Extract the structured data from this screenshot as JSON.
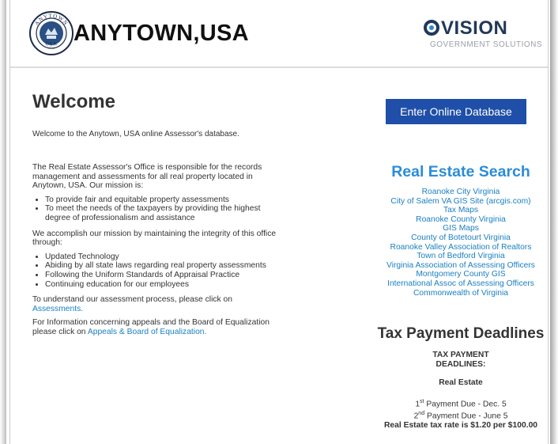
{
  "header": {
    "town_name": "ANYTOWN,USA",
    "seal_top_text": "ANYTOWN",
    "seal_bottom_text": "USA",
    "vision_word": "VISION",
    "vision_sub": "GOVERNMENT SOLUTIONS"
  },
  "welcome": {
    "title": "Welcome",
    "text": "Welcome to the Anytown, USA online Assessor's database."
  },
  "about": {
    "intro": "The Real Estate Assessor's Office is responsible for the records management and assessments for all real property located in Anytown, USA. Our mission is:",
    "mission": [
      "To provide fair and equitable property assessments",
      "To meet the needs of the taxpayers by providing the highest degree of professionalism and assistance"
    ],
    "accomplish": "We accomplish our mission by maintaining the integrity of this office through:",
    "methods": [
      "Updated Technology",
      "Abiding by all state laws regarding real property assessments",
      "Following the Uniform Standards of Appraisal Practice",
      "Continuing education for our employees"
    ],
    "assess_text": "To understand our assessment process, please click on",
    "assess_link": "Assessments.",
    "appeals_text": "For Information concerning appeals and the Board of Equalization please click on",
    "appeals_link": "Appeals & Board of Equalization."
  },
  "enter_button": "Enter Online Database",
  "real_estate": {
    "title": "Real Estate Search",
    "links": [
      "Roanoke City Virginia",
      "City of Salem VA GIS Site (arcgis.com)",
      "Tax Maps",
      "Roanoke County Virginia",
      "GIS Maps",
      "County of Botetourt Virginia",
      "Roanoke Valley Association of Realtors",
      "Town of Bedford Virginia",
      "Virginia Association of Assessing Officers",
      "Montgomery County GIS",
      "International Assoc of Assessing Officers",
      "Commonwealth of Virginia"
    ]
  },
  "tax": {
    "title": "Tax Payment Deadlines",
    "head_line1": "TAX PAYMENT",
    "head_line2": "DEADLINES:",
    "sub": "Real Estate",
    "first_sup": "st",
    "first_num": "1",
    "first_text": "Payment Due - Dec. 5",
    "second_sup": "nd",
    "second_num": "2",
    "second_text": "Payment Due - June 5",
    "rate": "Real Estate tax rate is $1.20 per $100.00"
  }
}
